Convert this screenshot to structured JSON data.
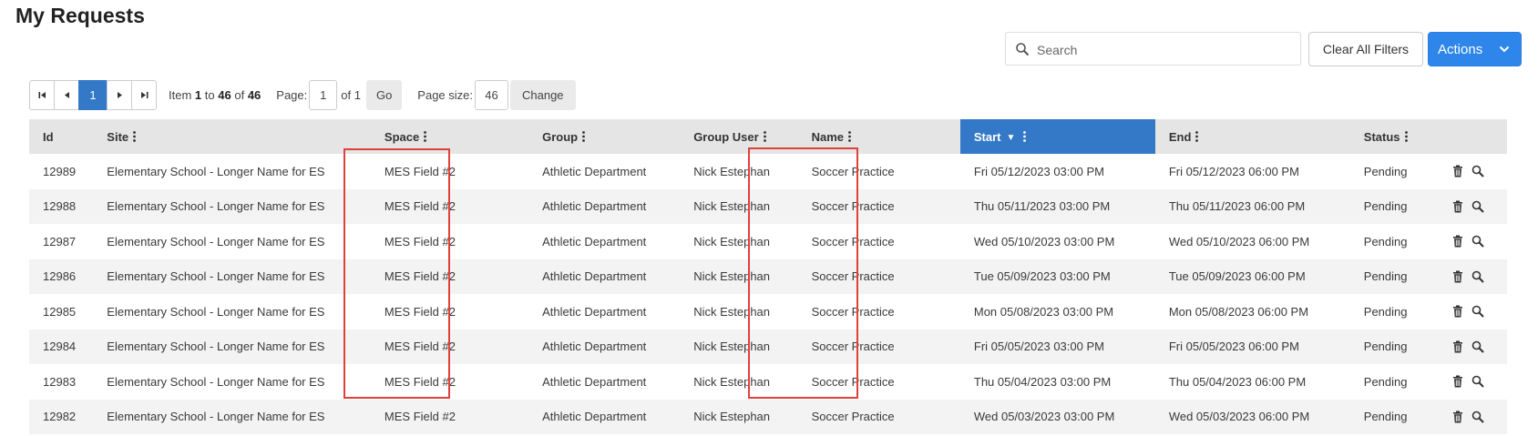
{
  "page": {
    "title": "My Requests"
  },
  "toolbar": {
    "search_placeholder": "Search",
    "clear_label": "Clear All Filters",
    "actions_label": "Actions"
  },
  "pager": {
    "current_page": "1",
    "item_prefix": "Item",
    "item_from": "1",
    "item_to_word": "to",
    "item_to": "46",
    "item_of_word": "of",
    "item_total": "46",
    "page_label": "Page:",
    "page_value": "1",
    "page_of": "of 1",
    "go_label": "Go",
    "size_label": "Page size:",
    "size_value": "46",
    "change_label": "Change"
  },
  "table": {
    "columns": [
      "Id",
      "Site",
      "Space",
      "Group",
      "Group User",
      "Name",
      "Start",
      "End",
      "Status"
    ],
    "sorted_column": "Start",
    "sort_direction": "descending",
    "rows": [
      {
        "id": "12989",
        "site": "Elementary School - Longer Name for ES",
        "space": "MES Field #2",
        "group": "Athletic Department",
        "group_user": "Nick Estephan",
        "name": "Soccer Practice",
        "start": "Fri 05/12/2023 03:00 PM",
        "end": "Fri 05/12/2023 06:00 PM",
        "status": "Pending"
      },
      {
        "id": "12988",
        "site": "Elementary School - Longer Name for ES",
        "space": "MES Field #2",
        "group": "Athletic Department",
        "group_user": "Nick Estephan",
        "name": "Soccer Practice",
        "start": "Thu 05/11/2023 03:00 PM",
        "end": "Thu 05/11/2023 06:00 PM",
        "status": "Pending"
      },
      {
        "id": "12987",
        "site": "Elementary School - Longer Name for ES",
        "space": "MES Field #2",
        "group": "Athletic Department",
        "group_user": "Nick Estephan",
        "name": "Soccer Practice",
        "start": "Wed 05/10/2023 03:00 PM",
        "end": "Wed 05/10/2023 06:00 PM",
        "status": "Pending"
      },
      {
        "id": "12986",
        "site": "Elementary School - Longer Name for ES",
        "space": "MES Field #2",
        "group": "Athletic Department",
        "group_user": "Nick Estephan",
        "name": "Soccer Practice",
        "start": "Tue 05/09/2023 03:00 PM",
        "end": "Tue 05/09/2023 06:00 PM",
        "status": "Pending"
      },
      {
        "id": "12985",
        "site": "Elementary School - Longer Name for ES",
        "space": "MES Field #2",
        "group": "Athletic Department",
        "group_user": "Nick Estephan",
        "name": "Soccer Practice",
        "start": "Mon 05/08/2023 03:00 PM",
        "end": "Mon 05/08/2023 06:00 PM",
        "status": "Pending"
      },
      {
        "id": "12984",
        "site": "Elementary School - Longer Name for ES",
        "space": "MES Field #2",
        "group": "Athletic Department",
        "group_user": "Nick Estephan",
        "name": "Soccer Practice",
        "start": "Fri 05/05/2023 03:00 PM",
        "end": "Fri 05/05/2023 06:00 PM",
        "status": "Pending"
      },
      {
        "id": "12983",
        "site": "Elementary School - Longer Name for ES",
        "space": "MES Field #2",
        "group": "Athletic Department",
        "group_user": "Nick Estephan",
        "name": "Soccer Practice",
        "start": "Thu 05/04/2023 03:00 PM",
        "end": "Thu 05/04/2023 06:00 PM",
        "status": "Pending"
      },
      {
        "id": "12982",
        "site": "Elementary School - Longer Name for ES",
        "space": "MES Field #2",
        "group": "Athletic Department",
        "group_user": "Nick Estephan",
        "name": "Soccer Practice",
        "start": "Wed 05/03/2023 03:00 PM",
        "end": "Wed 05/03/2023 06:00 PM",
        "status": "Pending"
      }
    ],
    "row_actions": [
      "trash-icon",
      "magnifier-icon"
    ],
    "highlighted_columns": [
      "Space",
      "Name"
    ]
  },
  "colors": {
    "accent": "#3479c7",
    "actions_button": "#2f86ea",
    "highlight_box": "#e0403b",
    "header_bg": "#e5e5e5",
    "stripe_bg": "#f3f3f3"
  }
}
